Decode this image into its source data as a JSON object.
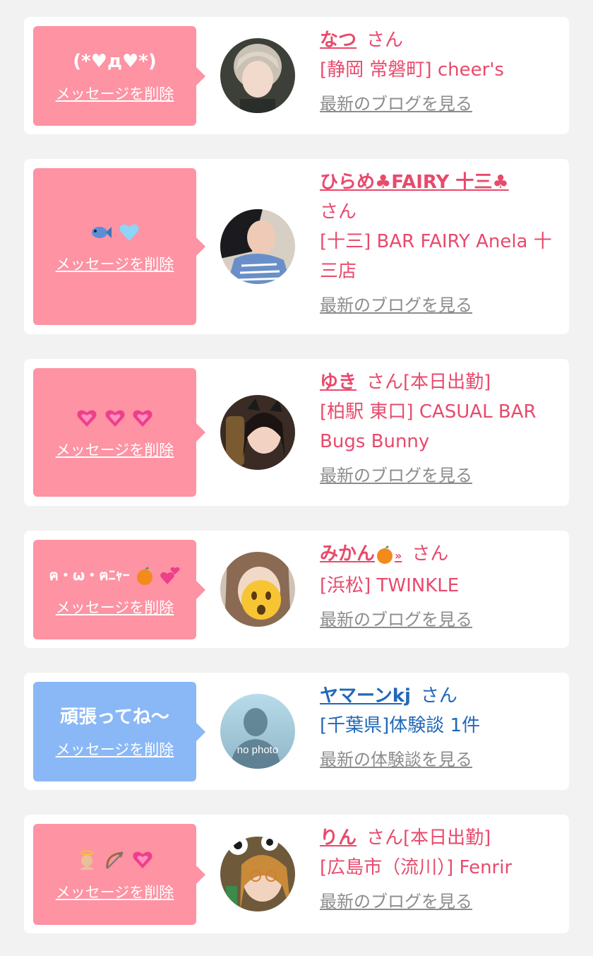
{
  "delete_label": "メッセージを削除",
  "san_label": "さん",
  "colors": {
    "pink_bubble": "#fd93a3",
    "blue_bubble": "#8ab8f6",
    "pink_text": "#e84a6c",
    "blue_text": "#2168b8",
    "link_gray": "#8c8c8c",
    "page_bg": "#f2f2f2"
  },
  "cards": [
    {
      "message": "(*♥д♥*)",
      "name": "なつ",
      "status": "",
      "shop": "[静岡 常磐町] cheer's",
      "link": "最新のブログを見る"
    },
    {
      "message": "",
      "message_icons": [
        "fish-icon",
        "light-blue-heart-icon"
      ],
      "name": "ひらめ♣FAIRY 十三♣",
      "status": "",
      "shop": "[十三] BAR FAIRY Anela 十三店",
      "link": "最新のブログを見る"
    },
    {
      "message": "",
      "message_icons": [
        "growing-heart-icon",
        "growing-heart-icon",
        "growing-heart-icon"
      ],
      "name": "ゆき",
      "status": "[本日出勤]",
      "shop": "[柏駅 東口] CASUAL BAR Bugs Bunny",
      "link": "最新のブログを見る"
    },
    {
      "message": "ฅ・ω・ฅﾆｬｰ",
      "message_icons": [
        "tangerine-icon",
        "two-hearts-icon"
      ],
      "name": "みかん",
      "name_suffix": "»",
      "name_icon": "tangerine-icon",
      "status": "",
      "shop": "[浜松] TWINKLE",
      "link": "最新のブログを見る"
    },
    {
      "message": "頑張ってね〜",
      "name": "ヤマーンkj",
      "status": "",
      "shop": "[千葉県]体験談 1件",
      "avatar_text": "no photo",
      "link": "最新の体験談を見る"
    },
    {
      "message": "",
      "message_icons": [
        "angel-icon",
        "bow-and-arrow-icon",
        "growing-heart-icon"
      ],
      "name": "りん",
      "status": "[本日出勤]",
      "shop": "[広島市（流川）] Fenrir",
      "link": "最新のブログを見る"
    }
  ]
}
